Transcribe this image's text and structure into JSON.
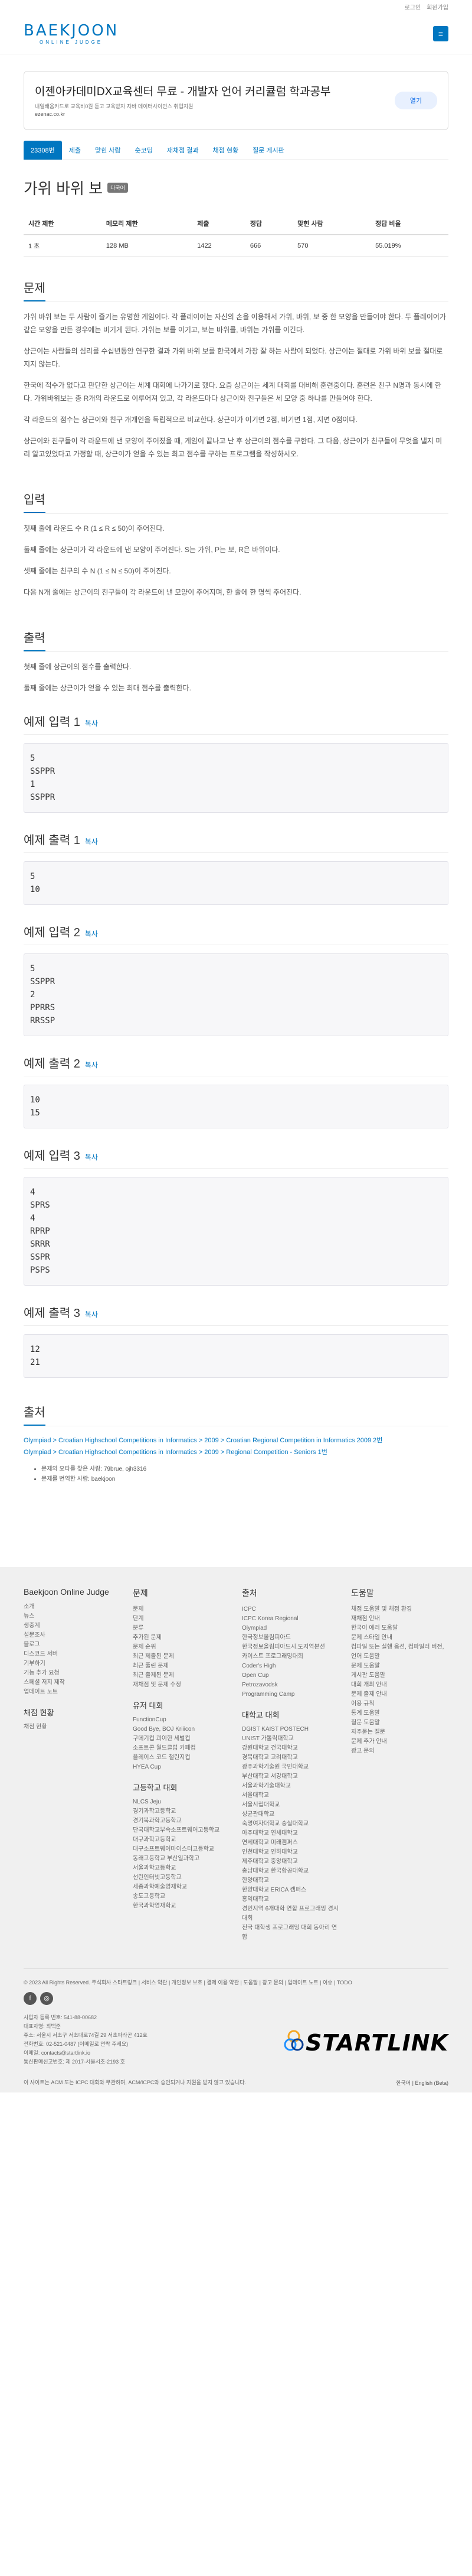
{
  "topbar": {
    "login": "로그인",
    "signup": "회원가입"
  },
  "header": {
    "logo": "BAEKJOON",
    "logo_sub": "ONLINE JUDGE",
    "menu_icon": "hamburger-icon"
  },
  "ad": {
    "title": "이젠아카데미DX교육센터 무료 - 개발자 언어 커리큘럼 학과공부",
    "desc": "내일배움카드로 교육비0원 듣고 교육받자 자바 데이터사이언스 취업지원",
    "url": "ezenac.co.kr",
    "open": "열기"
  },
  "tabs": [
    "23308번",
    "제출",
    "맞힌 사람",
    "숏코딩",
    "재채점 결과",
    "채점 현황",
    "질문 게시판"
  ],
  "problem": {
    "title": "가위 바위 보",
    "tag": "다국어"
  },
  "info_headers": [
    "시간 제한",
    "메모리 제한",
    "제출",
    "정답",
    "맞힌 사람",
    "정답 비율"
  ],
  "info_values": [
    "1 초",
    "128 MB",
    "1422",
    "666",
    "570",
    "55.019%"
  ],
  "sections": {
    "problem": "문제",
    "problem_paras": [
      "가위 바위 보는 두 사람이 즐기는 유명한 게임이다. 각 플레이어는 자신의 손을 이용해서 가위, 바위, 보 중 한 모양을 만들어야 한다. 두 플레이어가 같은 모양을 만든 경우에는 비기게 된다. 가위는 보를 이기고, 보는 바위를, 바위는 가위를 이긴다.",
      "상근이는 사람들의 심리를 수십년동안 연구한 결과 가위 바위 보를 한국에서 가장 잘 하는 사람이 되었다. 상근이는 절대로 가위 바위 보를 절대로 지지 않는다.",
      "한국에 적수가 없다고 판단한 상근이는 세계 대회에 나가기로 했다. 요즘 상근이는 세계 대회를 대비해 훈련중이다. 훈련은 친구 N명과 동시에 한다. 가위바위보는 총 R개의 라운드로 이루어져 있고, 각 라운드마다 상근이와 친구들은 세 모양 중 하나를 만들어야 한다.",
      "각 라운드의 점수는 상근이와 친구 개개인을 독립적으로 비교한다. 상근이가 이기면 2점, 비기면 1점, 지면 0점이다.",
      "상근이와 친구들이 각 라운드에 낸 모양이 주어졌을 때, 게임이 끝나고 난 후 상근이의 점수를 구한다. 그 다음, 상근이가 친구들이 무엇을 낼지 미리 알고있었다고 가정할 때, 상근이가 얻을 수 있는 최고 점수를 구하는 프로그램을 작성하시오."
    ],
    "input": "입력",
    "input_paras": [
      "첫째 줄에 라운드 수 R (1 ≤ R ≤ 50)이 주어진다.",
      "둘째 줄에는 상근이가 각 라운드에 낸 모양이 주어진다. S는 가위, P는 보, R은 바위이다.",
      "셋째 줄에는 친구의 수 N (1 ≤ N ≤ 50)이 주어진다.",
      "다음 N개 줄에는 상근이의 친구들이 각 라운드에 낸 모양이 주어지며, 한 줄에 한 명씩 주어진다."
    ],
    "output": "출력",
    "output_paras": [
      "첫째 줄에 상근이의 점수를 출력한다.",
      "둘째 줄에는 상근이가 얻을 수 있는 최대 점수를 출력한다."
    ],
    "copy": "복사",
    "source": "출처"
  },
  "examples": [
    {
      "in_title": "예제 입력 1",
      "in": "5\nSSPPR\n1\nSSPPR",
      "out_title": "예제 출력 1",
      "out": "5\n10"
    },
    {
      "in_title": "예제 입력 2",
      "in": "5\nSSPPR\n2\nPPRRS\nRRSSP",
      "out_title": "예제 출력 2",
      "out": "10\n15"
    },
    {
      "in_title": "예제 입력 3",
      "in": "4\nSPRS\n4\nRPRP\nSRRR\nSSPR\nPSPS",
      "out_title": "예제 출력 3",
      "out": "12\n21"
    }
  ],
  "source": {
    "line1": "Olympiad > Croatian Highschool Competitions in Informatics > 2009 > Croatian Regional Competition in Informatics 2009 2번",
    "line2": "Olympiad > Croatian Highschool Competitions in Informatics > 2009 > Regional Competition - Seniors 1번",
    "meta1": "문제의 오타를 찾은 사람: 79brue, ojh3316",
    "meta2": "문제를 번역한 사람: baekjoon"
  },
  "footer": {
    "brand": "Baekjoon Online Judge",
    "brand_items": [
      "소개",
      "뉴스",
      "생중계",
      "설문조사",
      "블로그",
      "디스코드 서버",
      "기부하기",
      "기능 추가 요청",
      "스페셜 저지 제작",
      "업데이트 노트"
    ],
    "grading": "채점 현황",
    "grading_items": [
      "채점 현황"
    ],
    "problems": "문제",
    "problem_items": [
      "문제",
      "단계",
      "분류",
      "추가된 문제",
      "문제 순위",
      "최근 제출된 문제",
      "최근 풀린 문제",
      "최근 출제된 문제",
      "재채점 및 문제 수정"
    ],
    "user_contests": "유저 대회",
    "user_contest_items": [
      "FunctionCup",
      "Good Bye, BOJ Kriiicon",
      "구데기컵 괴이한 세벌컵",
      "소프트콘 월드클럽 카페컵",
      "플레이스 코드 챌린지컵",
      "HYEA Cup"
    ],
    "hs_contests": "고등학교 대회",
    "hs_items": [
      "NLCS Jeju",
      "경기과학고등학교",
      "경기북과학고등학교",
      "단국대학교부속소프트웨어고등학교",
      "대구과학고등학교",
      "대구소프트웨어마이스터고등학교",
      "동래고등학교 부산일과학고",
      "서울과학고등학교",
      "선린인터넷고등학교",
      "세종과학예술영재학교",
      "송도고등학교",
      "한국과학영재학교"
    ],
    "source": "출처",
    "source_items": [
      "ICPC",
      "ICPC Korea Regional",
      "Olympiad",
      "한국정보올림피아드",
      "한국정보올림피아드시.도지역본선",
      "카이스트 프로그래밍대회",
      "Coder's High",
      "Open Cup",
      "Petrozavodsk",
      "Programming Camp"
    ],
    "univ": "대학교 대회",
    "univ_items": [
      "DGIST KAIST POSTECH",
      "UNIST 가톨릭대학교",
      "강원대학교 건국대학교",
      "경북대학교 고려대학교",
      "광주과학기술원 국민대학교",
      "부산대학교 서강대학교",
      "서울과학기술대학교",
      "서울대학교",
      "서울시립대학교",
      "성균관대학교",
      "숙명여자대학교 숭실대학교",
      "아주대학교 연세대학교",
      "연세대학교 미래캠퍼스",
      "인천대학교 인하대학교",
      "제주대학교 중앙대학교",
      "충남대학교 한국항공대학교",
      "한양대학교",
      "한양대학교 ERICA 캠퍼스",
      "홍익대학교",
      "경인지역 6개대학 연합 프로그래밍 경시대회",
      "전국 대학생 프로그래밍 대회 동아리 연합"
    ],
    "help": "도움말",
    "help_items": [
      "채점 도움말 및 채점 환경",
      "재채점 안내",
      "한국어 애러 도움말",
      "문제 스타일 안내",
      "컴파일 또는 실행 옵션, 컴파일러 버전, 언어 도움말",
      "문제 도움말",
      "게시판 도움말",
      "대회 개최 안내",
      "문제 출제 안내",
      "이용 규칙",
      "통계 도움말",
      "질문 도움말",
      "자주묻는 질문",
      "문제 추가 안내",
      "광고 문의"
    ]
  },
  "bottom": {
    "links": "© 2023 All Rights Reserved. 주식회사 스타트링크 | 서비스 약관 | 개인정보 보호 | 결제 이용 약관 | 도움말 | 광고 문의 | 업데이트 노트 | 이슈 | TODO",
    "company": "사업자 등록 번호: 541-88-00682",
    "ceo": "대표자명: 최백준",
    "addr": "주소: 서울시 서초구 서초대로74길 29 서초파라곤 412호",
    "tel": "전화번호: 02-521-0487 (이메일로 연락 주세요)",
    "email": "이메일: contacts@startlink.io",
    "license": "통신판매신고번호: 제 2017-서울서초-2193 호",
    "footnote": "이 사이트는 ACM 또는 ICPC 대회와 무관하며, ACM/ICPC와 승인되거나 지원을 받지 않고 있습니다.",
    "startlink": "STARTLINK",
    "langs": "한국어 | English (Beta)"
  }
}
